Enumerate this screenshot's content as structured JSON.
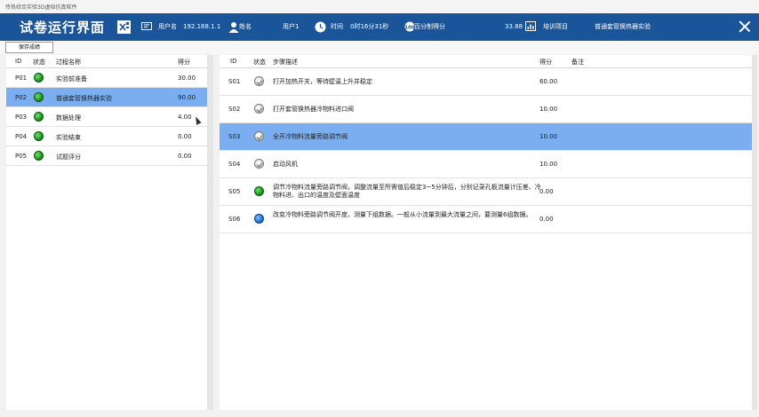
{
  "window_title": "传热综合实验3D虚拟仿真软件",
  "header": {
    "title": "试卷运行界面",
    "username_label": "用户名",
    "username_value": "192.168.1.1",
    "name_label": "姓名",
    "user_value": "用户1",
    "time_label": "时间",
    "time_value": "0时16分31秒",
    "score_label": "百分制得分",
    "score_value": "33.88",
    "project_label": "培训项目",
    "project_value": "普通套管换热器实验"
  },
  "toolbar": {
    "save_label": "保存成绩"
  },
  "left_table": {
    "headers": {
      "id": "ID",
      "status": "状态",
      "name": "过程名称",
      "score": "得分"
    },
    "rows": [
      {
        "id": "P01",
        "status": "green",
        "name": "实验前准备",
        "score": "30.00"
      },
      {
        "id": "P02",
        "status": "green",
        "name": "普通套管换热器实验",
        "score": "90.00",
        "selected": true
      },
      {
        "id": "P03",
        "status": "green",
        "name": "数据处理",
        "score": "4.00"
      },
      {
        "id": "P04",
        "status": "green",
        "name": "实验结束",
        "score": "0.00"
      },
      {
        "id": "P05",
        "status": "green",
        "name": "试题评分",
        "score": "0.00"
      }
    ]
  },
  "right_table": {
    "headers": {
      "id": "ID",
      "status": "状态",
      "desc": "步骤描述",
      "score": "得分",
      "note": "备注"
    },
    "rows": [
      {
        "id": "S01",
        "status": "grey",
        "desc": "打开加热开关，等待壁温上升并稳定",
        "score": "60.00"
      },
      {
        "id": "S02",
        "status": "grey",
        "desc": "打开套管换热器冷物料进口阀",
        "score": "10.00"
      },
      {
        "id": "S03",
        "status": "grey",
        "desc": "全开冷物料流量旁路调节阀",
        "score": "10.00",
        "selected": true
      },
      {
        "id": "S04",
        "status": "grey",
        "desc": "启动风机",
        "score": "10.00"
      },
      {
        "id": "S05",
        "status": "green",
        "desc": "调节冷物料流量旁路调节阀，调整流量至所需值后稳定3~5分钟后，分别记录孔板流量计压差、冷物料进、出口的温度及壁面温度",
        "score": "0.00"
      },
      {
        "id": "S06",
        "status": "blue",
        "desc": "改变冷物料旁路调节阀开度，测量下组数据。一般从小流量到最大流量之间，要测量6组数据。",
        "score": "0.00"
      }
    ]
  },
  "colors": {
    "header_bg": "#1a5499",
    "selected_row": "#7aaef0"
  }
}
